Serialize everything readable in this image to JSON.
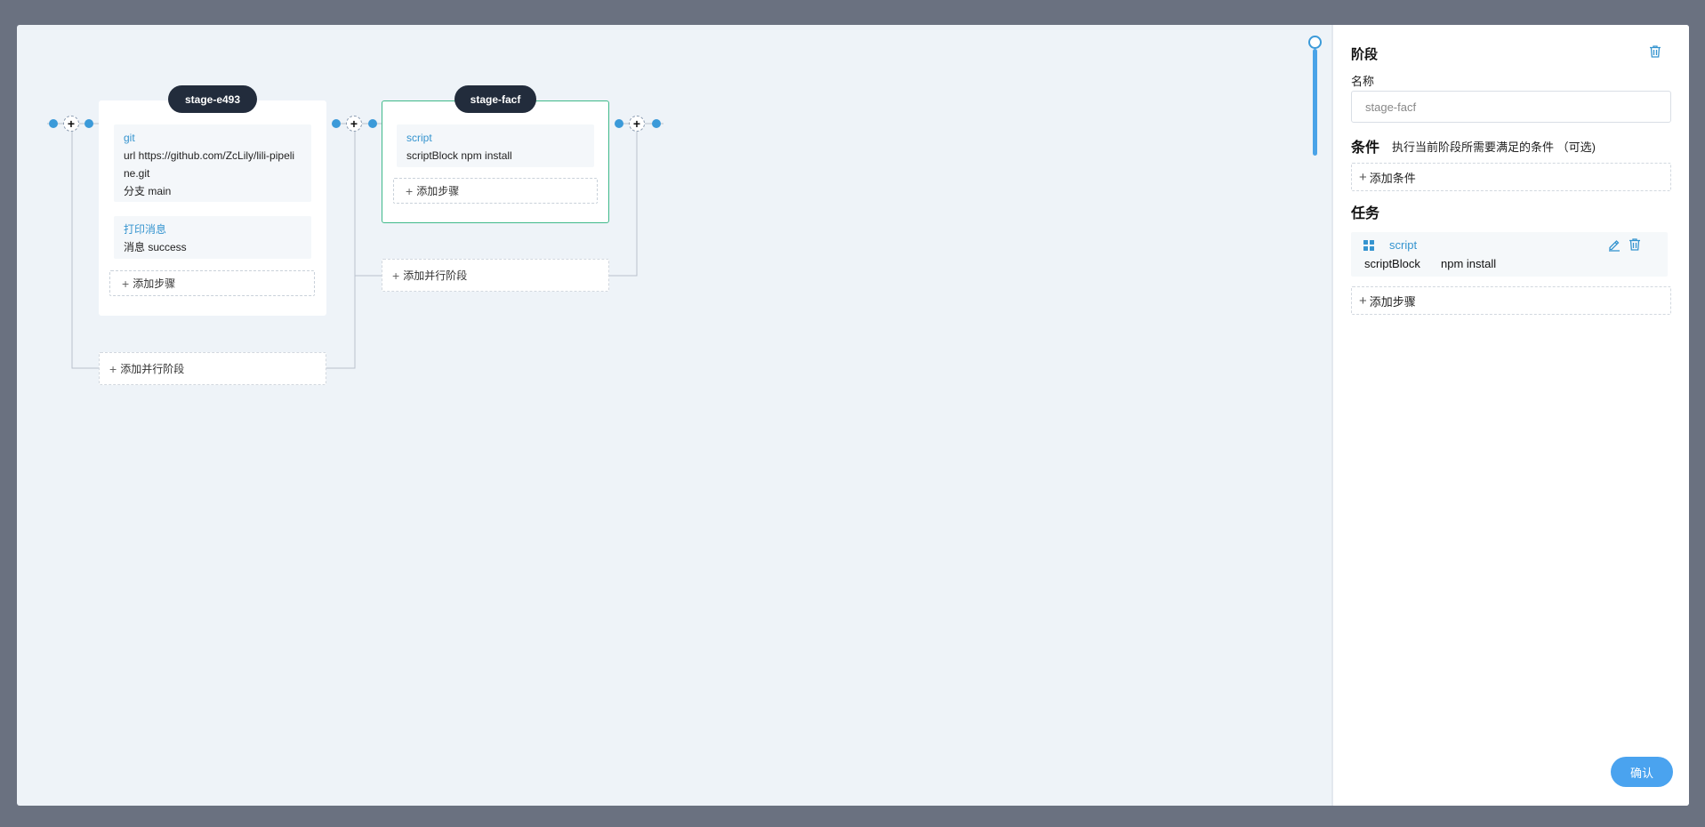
{
  "stages": [
    {
      "name": "stage-e493",
      "steps": [
        {
          "title": "git",
          "lines": [
            "url https://github.com/ZcLily/lili-pipeli",
            "ne.git",
            "分支 main"
          ]
        },
        {
          "title": "打印消息",
          "lines": [
            "消息 success"
          ]
        }
      ],
      "add_step_label": "添加步骤",
      "add_parallel_label": "添加并行阶段"
    },
    {
      "name": "stage-facf",
      "selected": true,
      "steps": [
        {
          "title": "script",
          "lines": [
            "scriptBlock npm install"
          ]
        }
      ],
      "add_step_label": "添加步骤",
      "add_parallel_label": "添加并行阶段"
    }
  ],
  "add_node_symbol": "+",
  "panel": {
    "title": "阶段",
    "name_label": "名称",
    "name_placeholder": "stage-facf",
    "conditions_title": "条件",
    "conditions_hint": "执行当前阶段所需要满足的条件 （可选)",
    "add_condition_label": "添加条件",
    "tasks_title": "任务",
    "task": {
      "name": "script",
      "key": "scriptBlock",
      "value": "npm install"
    },
    "add_step_label": "添加步骤",
    "confirm_label": "确认"
  },
  "colors": {
    "accent": "#3b9ad9",
    "stage_pill": "#222c3c",
    "selected_border": "#3fb98a",
    "confirm": "#4aa3ef",
    "backdrop": "#6a7180"
  },
  "icons": [
    "plus-icon",
    "trash-icon",
    "edit-icon",
    "grid-drag-icon"
  ]
}
